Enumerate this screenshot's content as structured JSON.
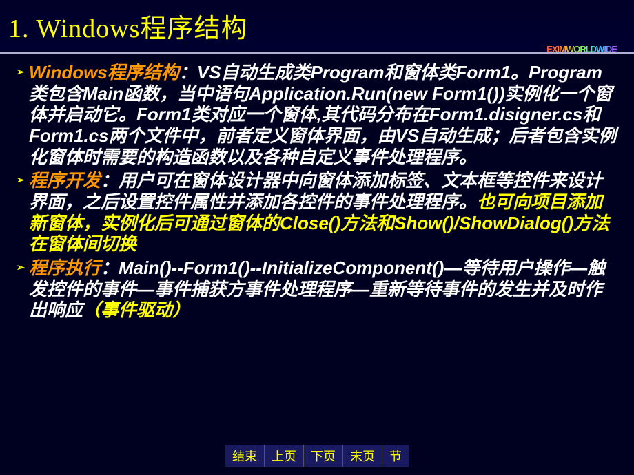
{
  "title": "1. Windows程序结构",
  "decor": "EXIMWORLDWIDE",
  "bullets": [
    {
      "parts": [
        {
          "text": "Windows程序结构",
          "cls": "orange"
        },
        {
          "text": "：VS自动生成类Program和窗体类Form1。Program类包含Main函数，当中语句Application.Run(new Form1())实例化一个窗体并启动它。Form1类对应一个窗体,其代码分布在Form1.disigner.cs和Form1.cs两个文件中，前者定义窗体界面，由VS自动生成；后者包含实例化窗体时需要的构造函数以及各种自定义事件处理程序。",
          "cls": "white"
        }
      ]
    },
    {
      "parts": [
        {
          "text": "程序开发",
          "cls": "orange"
        },
        {
          "text": "：用户可在窗体设计器中向窗体添加标签、文本框等控件来设计界面，之后设置控件属性并添加各控件的事件处理程序。",
          "cls": "white"
        },
        {
          "text": "也可向项目添加新窗体，实例化后可通过窗体的Close()方法和Show()/ShowDialog()方法在窗体间切换",
          "cls": "yellow"
        }
      ]
    },
    {
      "parts": [
        {
          "text": "程序执行",
          "cls": "orange"
        },
        {
          "text": "：Main()--Form1()--InitializeComponent()—等待用户操作—触发控件的事件—事件捕获方事件处理程序—重新等待事件的发生并及时作出响应",
          "cls": "white"
        },
        {
          "text": "（事件驱动）",
          "cls": "yellow"
        }
      ]
    }
  ],
  "nav": {
    "end": "结束",
    "prev": "上页",
    "next": "下页",
    "last": "末页",
    "section": "节"
  }
}
